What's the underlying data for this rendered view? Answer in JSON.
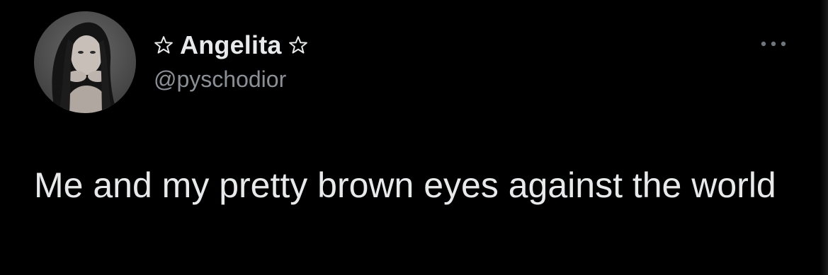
{
  "author": {
    "display_name": "Angelita",
    "handle": "@pyschodior",
    "name_prefix_icon": "star-outline-icon",
    "name_suffix_icon": "star-outline-icon"
  },
  "tweet": {
    "text": "Me and my pretty brown eyes against the world"
  },
  "actions": {
    "more_icon": "more-horizontal-icon"
  },
  "colors": {
    "background": "#000000",
    "primary_text": "#e7e9ea",
    "secondary_text": "#8b9096"
  }
}
